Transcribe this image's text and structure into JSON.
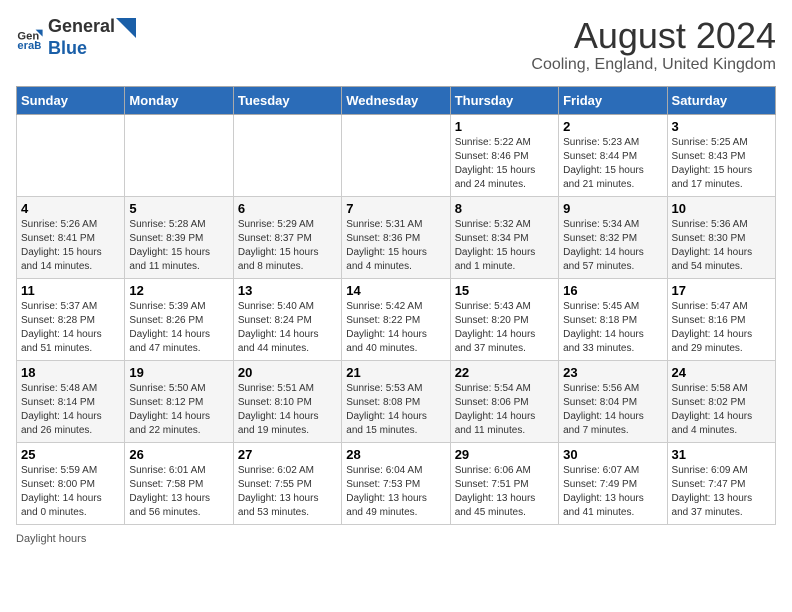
{
  "header": {
    "logo_general": "General",
    "logo_blue": "Blue",
    "main_title": "August 2024",
    "subtitle": "Cooling, England, United Kingdom"
  },
  "calendar": {
    "days_of_week": [
      "Sunday",
      "Monday",
      "Tuesday",
      "Wednesday",
      "Thursday",
      "Friday",
      "Saturday"
    ],
    "weeks": [
      [
        {
          "day": "",
          "info": ""
        },
        {
          "day": "",
          "info": ""
        },
        {
          "day": "",
          "info": ""
        },
        {
          "day": "",
          "info": ""
        },
        {
          "day": "1",
          "info": "Sunrise: 5:22 AM\nSunset: 8:46 PM\nDaylight: 15 hours\nand 24 minutes."
        },
        {
          "day": "2",
          "info": "Sunrise: 5:23 AM\nSunset: 8:44 PM\nDaylight: 15 hours\nand 21 minutes."
        },
        {
          "day": "3",
          "info": "Sunrise: 5:25 AM\nSunset: 8:43 PM\nDaylight: 15 hours\nand 17 minutes."
        }
      ],
      [
        {
          "day": "4",
          "info": "Sunrise: 5:26 AM\nSunset: 8:41 PM\nDaylight: 15 hours\nand 14 minutes."
        },
        {
          "day": "5",
          "info": "Sunrise: 5:28 AM\nSunset: 8:39 PM\nDaylight: 15 hours\nand 11 minutes."
        },
        {
          "day": "6",
          "info": "Sunrise: 5:29 AM\nSunset: 8:37 PM\nDaylight: 15 hours\nand 8 minutes."
        },
        {
          "day": "7",
          "info": "Sunrise: 5:31 AM\nSunset: 8:36 PM\nDaylight: 15 hours\nand 4 minutes."
        },
        {
          "day": "8",
          "info": "Sunrise: 5:32 AM\nSunset: 8:34 PM\nDaylight: 15 hours\nand 1 minute."
        },
        {
          "day": "9",
          "info": "Sunrise: 5:34 AM\nSunset: 8:32 PM\nDaylight: 14 hours\nand 57 minutes."
        },
        {
          "day": "10",
          "info": "Sunrise: 5:36 AM\nSunset: 8:30 PM\nDaylight: 14 hours\nand 54 minutes."
        }
      ],
      [
        {
          "day": "11",
          "info": "Sunrise: 5:37 AM\nSunset: 8:28 PM\nDaylight: 14 hours\nand 51 minutes."
        },
        {
          "day": "12",
          "info": "Sunrise: 5:39 AM\nSunset: 8:26 PM\nDaylight: 14 hours\nand 47 minutes."
        },
        {
          "day": "13",
          "info": "Sunrise: 5:40 AM\nSunset: 8:24 PM\nDaylight: 14 hours\nand 44 minutes."
        },
        {
          "day": "14",
          "info": "Sunrise: 5:42 AM\nSunset: 8:22 PM\nDaylight: 14 hours\nand 40 minutes."
        },
        {
          "day": "15",
          "info": "Sunrise: 5:43 AM\nSunset: 8:20 PM\nDaylight: 14 hours\nand 37 minutes."
        },
        {
          "day": "16",
          "info": "Sunrise: 5:45 AM\nSunset: 8:18 PM\nDaylight: 14 hours\nand 33 minutes."
        },
        {
          "day": "17",
          "info": "Sunrise: 5:47 AM\nSunset: 8:16 PM\nDaylight: 14 hours\nand 29 minutes."
        }
      ],
      [
        {
          "day": "18",
          "info": "Sunrise: 5:48 AM\nSunset: 8:14 PM\nDaylight: 14 hours\nand 26 minutes."
        },
        {
          "day": "19",
          "info": "Sunrise: 5:50 AM\nSunset: 8:12 PM\nDaylight: 14 hours\nand 22 minutes."
        },
        {
          "day": "20",
          "info": "Sunrise: 5:51 AM\nSunset: 8:10 PM\nDaylight: 14 hours\nand 19 minutes."
        },
        {
          "day": "21",
          "info": "Sunrise: 5:53 AM\nSunset: 8:08 PM\nDaylight: 14 hours\nand 15 minutes."
        },
        {
          "day": "22",
          "info": "Sunrise: 5:54 AM\nSunset: 8:06 PM\nDaylight: 14 hours\nand 11 minutes."
        },
        {
          "day": "23",
          "info": "Sunrise: 5:56 AM\nSunset: 8:04 PM\nDaylight: 14 hours\nand 7 minutes."
        },
        {
          "day": "24",
          "info": "Sunrise: 5:58 AM\nSunset: 8:02 PM\nDaylight: 14 hours\nand 4 minutes."
        }
      ],
      [
        {
          "day": "25",
          "info": "Sunrise: 5:59 AM\nSunset: 8:00 PM\nDaylight: 14 hours\nand 0 minutes."
        },
        {
          "day": "26",
          "info": "Sunrise: 6:01 AM\nSunset: 7:58 PM\nDaylight: 13 hours\nand 56 minutes."
        },
        {
          "day": "27",
          "info": "Sunrise: 6:02 AM\nSunset: 7:55 PM\nDaylight: 13 hours\nand 53 minutes."
        },
        {
          "day": "28",
          "info": "Sunrise: 6:04 AM\nSunset: 7:53 PM\nDaylight: 13 hours\nand 49 minutes."
        },
        {
          "day": "29",
          "info": "Sunrise: 6:06 AM\nSunset: 7:51 PM\nDaylight: 13 hours\nand 45 minutes."
        },
        {
          "day": "30",
          "info": "Sunrise: 6:07 AM\nSunset: 7:49 PM\nDaylight: 13 hours\nand 41 minutes."
        },
        {
          "day": "31",
          "info": "Sunrise: 6:09 AM\nSunset: 7:47 PM\nDaylight: 13 hours\nand 37 minutes."
        }
      ]
    ]
  },
  "footer": {
    "note": "Daylight hours"
  }
}
